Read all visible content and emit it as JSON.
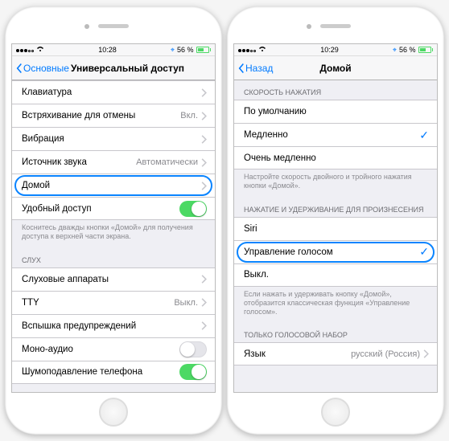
{
  "left": {
    "status": {
      "time": "10:28",
      "batt": "56 %"
    },
    "nav": {
      "back": "Основные",
      "title": "Универсальный доступ"
    },
    "rows": {
      "keyboard": "Клавиатура",
      "shake": {
        "label": "Встряхивание для отмены",
        "value": "Вкл."
      },
      "vibration": "Вибрация",
      "source": {
        "label": "Источник звука",
        "value": "Автоматически"
      },
      "home": "Домой",
      "reach": "Удобный доступ"
    },
    "footer1": "Коснитесь дважды кнопки «Домой» для получения доступа к верхней части экрана.",
    "hearingHeader": "СЛУХ",
    "hearing": {
      "devices": "Слуховые аппараты",
      "tty": {
        "label": "TTY",
        "value": "Выкл."
      },
      "flash": "Вспышка предупреждений",
      "mono": "Моно-аудио",
      "noise": "Шумоподавление телефона"
    }
  },
  "right": {
    "status": {
      "time": "10:29",
      "batt": "56 %"
    },
    "nav": {
      "back": "Назад",
      "title": "Домой"
    },
    "speedHeader": "СКОРОСТЬ НАЖАТИЯ",
    "speed": {
      "def": "По умолчанию",
      "slow": "Медленно",
      "vslow": "Очень медленно"
    },
    "footer1": "Настройте скорость двойного и тройного нажатия кнопки «Домой».",
    "holdHeader": "НАЖАТИЕ И УДЕРЖИВАНИЕ ДЛЯ ПРОИЗНЕСЕНИЯ",
    "hold": {
      "siri": "Siri",
      "voice": "Управление голосом",
      "off": "Выкл."
    },
    "footer2": "Если нажать и удерживать кнопку «Домой», отобразится классическая функция «Управление голосом».",
    "dialHeader": "ТОЛЬКО ГОЛОСОВОЙ НАБОР",
    "lang": {
      "label": "Язык",
      "value": "русский (Россия)"
    }
  }
}
